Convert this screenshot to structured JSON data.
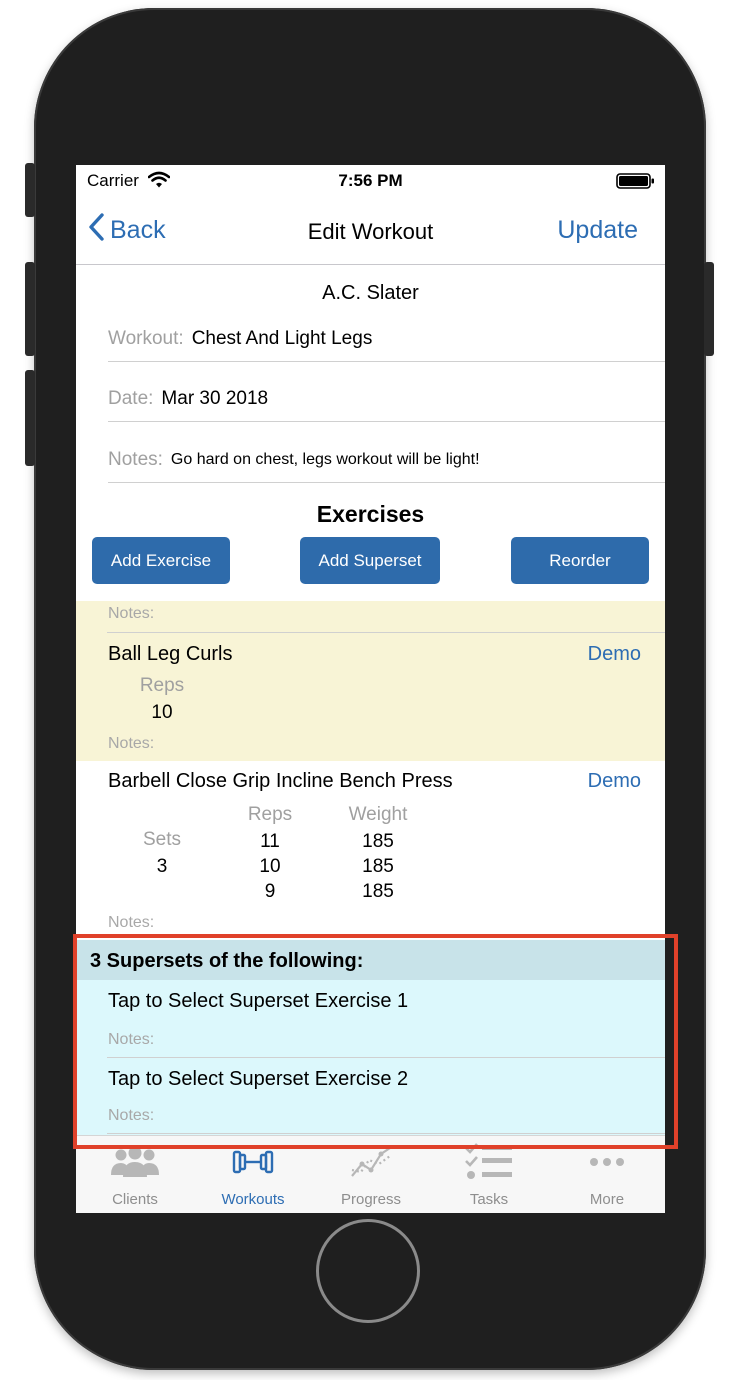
{
  "status_bar": {
    "carrier": "Carrier",
    "time": "7:56 PM"
  },
  "nav": {
    "back_label": "Back",
    "title": "Edit Workout",
    "update_label": "Update"
  },
  "client_name": "A.C. Slater",
  "form": {
    "workout_label": "Workout:",
    "workout_value": "Chest And Light Legs",
    "date_label": "Date:",
    "date_value": "Mar 30 2018",
    "notes_label": "Notes:",
    "notes_value": "Go hard on chest, legs workout will be light!"
  },
  "exercises": {
    "section_title": "Exercises",
    "add_exercise_label": "Add Exercise",
    "add_superset_label": "Add Superset",
    "reorder_label": "Reorder"
  },
  "superset_block": {
    "top_notes_label": "Notes:",
    "exercise_name": "Ball Leg Curls",
    "demo_label": "Demo",
    "reps_header": "Reps",
    "reps_value": "10",
    "notes_label": "Notes:"
  },
  "exercise_row": {
    "name": "Barbell Close Grip Incline Bench Press",
    "demo_label": "Demo",
    "sets_header": "Sets",
    "sets_value": "3",
    "reps_header": "Reps",
    "weight_header": "Weight",
    "reps_values": [
      "11",
      "10",
      "9"
    ],
    "weight_values": [
      "185",
      "185",
      "185"
    ],
    "notes_label": "Notes:"
  },
  "new_superset": {
    "header": "3 Supersets of the following:",
    "exercise_1": "Tap to Select Superset Exercise 1",
    "notes_1": "Notes:",
    "exercise_2": "Tap to Select Superset Exercise 2",
    "notes_2": "Notes:"
  },
  "tabs": [
    {
      "label": "Clients",
      "icon": "clients-icon"
    },
    {
      "label": "Workouts",
      "icon": "dumbbell-icon"
    },
    {
      "label": "Progress",
      "icon": "progress-icon"
    },
    {
      "label": "Tasks",
      "icon": "tasks-icon"
    },
    {
      "label": "More",
      "icon": "more-icon"
    }
  ],
  "colors": {
    "accent": "#2d6db3",
    "button_fill": "#2e6bab",
    "superset_bg": "#f8f4d6",
    "new_superset_bg": "#dcf8fc",
    "new_superset_header_bg": "#c8e3e9",
    "highlight": "#e0412a"
  }
}
